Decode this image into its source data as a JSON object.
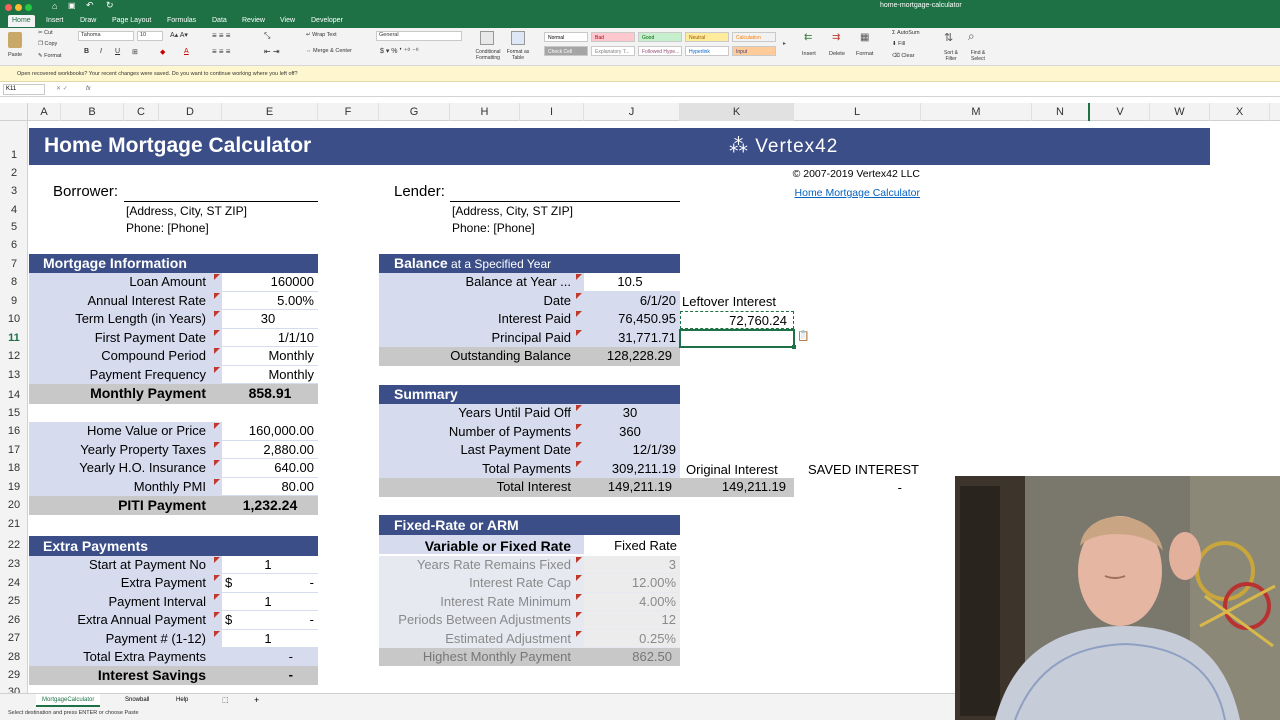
{
  "window": {
    "title": "home-mortgage-calculator"
  },
  "ribbon_tabs": [
    "Home",
    "Insert",
    "Draw",
    "Page Layout",
    "Formulas",
    "Data",
    "Review",
    "View",
    "Developer"
  ],
  "ribbon": {
    "paste": "Paste",
    "cut": "Cut",
    "copy": "Copy",
    "format": "Format",
    "font_name": "Tahoma",
    "font_size": "10",
    "wrap_text": "Wrap Text",
    "merge_center": "Merge & Center",
    "number_format": "General",
    "cond_format": "Conditional Formatting",
    "format_table": "Format as Table",
    "styles": [
      {
        "label": "Normal",
        "bg": "#ffffff",
        "fg": "#000000"
      },
      {
        "label": "Bad",
        "bg": "#ffc7ce",
        "fg": "#9c0006"
      },
      {
        "label": "Good",
        "bg": "#c6efce",
        "fg": "#006100"
      },
      {
        "label": "Neutral",
        "bg": "#ffeb9c",
        "fg": "#9c5700"
      },
      {
        "label": "Calculation",
        "bg": "#f2f2f2",
        "fg": "#fa7d00"
      },
      {
        "label": "Check Cell",
        "bg": "#a5a5a5",
        "fg": "#ffffff"
      },
      {
        "label": "Explanatory T...",
        "bg": "#ffffff",
        "fg": "#7f7f7f"
      },
      {
        "label": "Followed Hype...",
        "bg": "#ffffff",
        "fg": "#954f72"
      },
      {
        "label": "Hyperlink",
        "bg": "#ffffff",
        "fg": "#0563c1"
      },
      {
        "label": "Input",
        "bg": "#ffcc99",
        "fg": "#3f3f76"
      }
    ],
    "insert": "Insert",
    "delete": "Delete",
    "format_cells": "Format",
    "autosum": "AutoSum",
    "fill": "Fill",
    "clear": "Clear",
    "sort_filter": "Sort & Filter",
    "find_select": "Find & Select"
  },
  "message_bar": "Open recovered workbooks?  Your recent changes were saved. Do you want to continue working where you left off?",
  "formula_bar": {
    "name_box": "K11",
    "fx": "fx",
    "value": ""
  },
  "columns": [
    "A",
    "B",
    "C",
    "D",
    "E",
    "F",
    "G",
    "H",
    "I",
    "J",
    "K",
    "L",
    "M",
    "N",
    "V",
    "W",
    "X"
  ],
  "rows": [
    "1",
    "2",
    "3",
    "4",
    "5",
    "6",
    "7",
    "8",
    "9",
    "10",
    "11",
    "12",
    "13",
    "14",
    "15",
    "16",
    "17",
    "18",
    "19",
    "20",
    "21",
    "22",
    "23",
    "24",
    "25",
    "26",
    "27",
    "28",
    "29",
    "30"
  ],
  "sheet": {
    "title": "Home Mortgage Calculator",
    "logo": "Vertex42",
    "copyright": "© 2007-2019 Vertex42 LLC",
    "link": "Home Mortgage Calculator",
    "borrower": "Borrower:",
    "borrower_address": "[Address, City, ST ZIP]",
    "borrower_phone": "Phone: [Phone]",
    "lender": "Lender:",
    "lender_address": "[Address, City, ST ZIP]",
    "lender_phone": "Phone: [Phone]",
    "mortgage_info": {
      "header": "Mortgage Information",
      "rows": [
        {
          "label": "Loan Amount",
          "value": "160000"
        },
        {
          "label": "Annual Interest Rate",
          "value": "5.00%"
        },
        {
          "label": "Term Length (in Years)",
          "value": "30"
        },
        {
          "label": "First Payment Date",
          "value": "1/1/10"
        },
        {
          "label": "Compound Period",
          "value": "Monthly"
        },
        {
          "label": "Payment Frequency",
          "value": "Monthly"
        }
      ],
      "monthly_payment_label": "Monthly Payment",
      "monthly_payment_value": "858.91"
    },
    "piti": {
      "rows": [
        {
          "label": "Home Value or Price",
          "value": "160,000.00"
        },
        {
          "label": "Yearly Property Taxes",
          "value": "2,880.00"
        },
        {
          "label": "Yearly H.O. Insurance",
          "value": "640.00"
        },
        {
          "label": "Monthly PMI",
          "value": "80.00"
        }
      ],
      "total_label": "PITI Payment",
      "total_value": "1,232.24"
    },
    "extra": {
      "header": "Extra Payments",
      "rows": [
        {
          "label": "Start at Payment No",
          "cur": "",
          "value": "1"
        },
        {
          "label": "Extra Payment",
          "cur": "$",
          "value": "-"
        },
        {
          "label": "Payment Interval",
          "cur": "",
          "value": "1"
        },
        {
          "label": "Extra Annual Payment",
          "cur": "$",
          "value": "-"
        },
        {
          "label": "Payment # (1-12)",
          "cur": "",
          "value": "1"
        }
      ],
      "total_label": "Total Extra Payments",
      "total_value": "-",
      "savings_label": "Interest Savings",
      "savings_value": "-"
    },
    "balance": {
      "header_bold": "Balance",
      "header_rest": " at a Specified Year",
      "rows": [
        {
          "label": "Balance at Year ...",
          "value": "10.5"
        },
        {
          "label": "Date",
          "value": "6/1/20"
        },
        {
          "label": "Interest Paid",
          "value": "76,450.95"
        },
        {
          "label": "Principal Paid",
          "value": "31,771.71"
        }
      ],
      "outstanding_label": "Outstanding Balance",
      "outstanding_value": "128,228.29",
      "leftover_label": "Leftover Interest",
      "leftover_value": "72,760.24"
    },
    "summary": {
      "header": "Summary",
      "rows": [
        {
          "label": "Years Until Paid Off",
          "value": "30"
        },
        {
          "label": "Number of Payments",
          "value": "360"
        },
        {
          "label": "Last Payment Date",
          "value": "12/1/39"
        },
        {
          "label": "Total Payments",
          "value": "309,211.19"
        }
      ],
      "total_interest_label": "Total Interest",
      "total_interest_value": "149,211.19",
      "original_interest_label": "Original Interest",
      "original_interest_value": "149,211.19",
      "saved_interest_label": "SAVED INTEREST",
      "saved_interest_value": "-"
    },
    "arm": {
      "header": "Fixed-Rate or ARM",
      "type_label": "Variable or Fixed Rate",
      "type_value": "Fixed Rate",
      "rows": [
        {
          "label": "Years Rate Remains Fixed",
          "value": "3"
        },
        {
          "label": "Interest Rate Cap",
          "value": "12.00%"
        },
        {
          "label": "Interest Rate Minimum",
          "value": "4.00%"
        },
        {
          "label": "Periods Between Adjustments",
          "value": "12"
        },
        {
          "label": "Estimated Adjustment",
          "value": "0.25%"
        }
      ],
      "highest_label": "Highest Monthly Payment",
      "highest_value": "862.50"
    }
  },
  "sheet_tabs": [
    "MortgageCalculator",
    "Snowball",
    "Help"
  ],
  "status_bar": "Select destination and press ENTER or choose Paste",
  "colors": {
    "excel_green": "#1e7145",
    "header_blue": "#3b4e87",
    "label_blue": "#d6dcee",
    "grey": "#c8c8c8",
    "triangle": "#c0392b",
    "link": "#0563c1"
  }
}
